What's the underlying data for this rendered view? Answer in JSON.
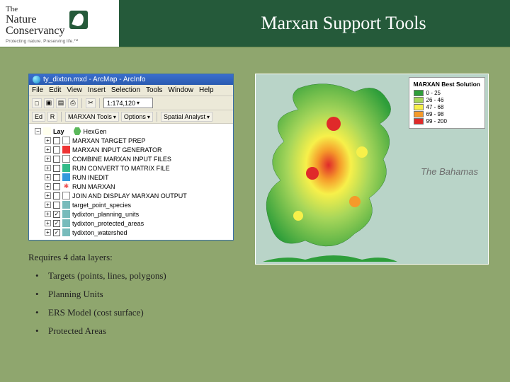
{
  "header": {
    "logo_line1": "The",
    "logo_line2": "Nature",
    "logo_line3": "Conservancy",
    "tagline": "Protecting nature. Preserving life.™",
    "title": "Marxan Support Tools"
  },
  "arcmap": {
    "window_title": "ty_dixton.mxd - ArcMap - ArcInfo",
    "menu": [
      "File",
      "Edit",
      "View",
      "Insert",
      "Selection",
      "Tools",
      "Window",
      "Help"
    ],
    "toolbar1": {
      "new": "□",
      "open": "▣",
      "save": "▤",
      "print": "⎙",
      "cut": "✂",
      "scale": "1:174,120"
    },
    "toolbar2": {
      "editor": "Ed",
      "r": "R",
      "marxan_tools": "MARXAN Tools",
      "options": "Options",
      "spatial": "Spatial Analyst"
    },
    "toc": {
      "root_label": "Lay",
      "hexgen": "HexGen",
      "items": [
        {
          "label": "MARXAN TARGET PREP",
          "icon": "doc"
        },
        {
          "label": "MARXAN INPUT GENERATOR",
          "icon": "red"
        },
        {
          "label": "COMBINE MARXAN INPUT FILES",
          "icon": "doc"
        },
        {
          "label": "RUN CONVERT TO MATRIX FILE",
          "icon": "green"
        },
        {
          "label": "RUN INEDIT",
          "icon": "blue"
        },
        {
          "label": "RUN MARXAN",
          "icon": "star"
        },
        {
          "label": "JOIN AND DISPLAY MARXAN OUTPUT",
          "icon": "doc"
        }
      ],
      "layers": [
        {
          "label": "target_point_species",
          "checked": false
        },
        {
          "label": "tydixton_planning_units",
          "checked": true
        },
        {
          "label": "tydixton_protected_areas",
          "checked": true
        },
        {
          "label": "tydixton_watershed",
          "checked": true
        }
      ]
    }
  },
  "requirements": {
    "heading": "Requires 4 data layers:",
    "items": [
      "Targets (points, lines, polygons)",
      "Planning Units",
      "ERS Model (cost surface)",
      "Protected Areas"
    ]
  },
  "map": {
    "legend_title": "MARXAN Best Solution",
    "classes": [
      {
        "range": "0 - 25",
        "color": "#2e9e3a"
      },
      {
        "range": "26 - 46",
        "color": "#a7d65a"
      },
      {
        "range": "47 - 68",
        "color": "#f7f04a"
      },
      {
        "range": "69 - 98",
        "color": "#f59a2a"
      },
      {
        "range": "99 - 200",
        "color": "#e02a2a"
      }
    ],
    "label": "The Bahamas"
  },
  "chart_data": {
    "type": "table",
    "title": "MARXAN Best Solution legend",
    "categories": [
      "0 - 25",
      "26 - 46",
      "47 - 68",
      "69 - 98",
      "99 - 200"
    ],
    "values": [
      "#2e9e3a",
      "#a7d65a",
      "#f7f04a",
      "#f59a2a",
      "#e02a2a"
    ]
  }
}
